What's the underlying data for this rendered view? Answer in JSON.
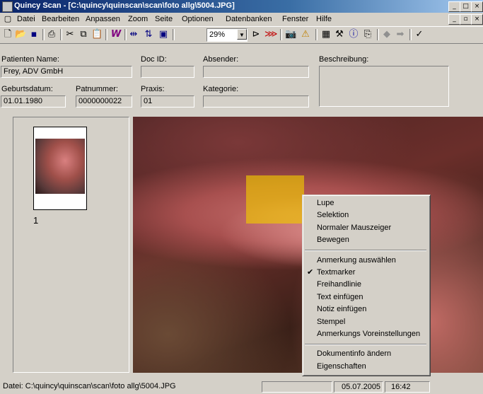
{
  "window": {
    "title": "Quincy Scan - [C:\\quincy\\quinscan\\scan\\foto allg\\5004.JPG]"
  },
  "menu": [
    "Datei",
    "Bearbeiten",
    "Anpassen",
    "Zoom",
    "Seite",
    "Optionen",
    "Datenbanken",
    "Fenster",
    "Hilfe"
  ],
  "toolbar": {
    "zoom_value": "29%"
  },
  "form": {
    "patient_name_label": "Patienten Name:",
    "patient_name": "Frey, ADV GmbH",
    "doc_id_label": "Doc ID:",
    "doc_id": "",
    "absender_label": "Absender:",
    "absender": "",
    "beschreibung_label": "Beschreibung:",
    "beschreibung": "",
    "geburtsdatum_label": "Geburtsdatum:",
    "geburtsdatum": "01.01.1980",
    "patnummer_label": "Patnummer:",
    "patnummer": "0000000022",
    "praxis_label": "Praxis:",
    "praxis": "01",
    "kategorie_label": "Kategorie:",
    "kategorie": ""
  },
  "thumbnail": {
    "page_number": "1"
  },
  "context_menu": {
    "group1": [
      "Lupe",
      "Selektion",
      "Normaler Mauszeiger",
      "Bewegen"
    ],
    "group2": [
      "Anmerkung auswählen",
      "Textmarker",
      "Freihandlinie",
      "Text einfügen",
      "Notiz einfügen",
      "Stempel",
      "Anmerkungs Voreinstellungen"
    ],
    "group3": [
      "Dokumentinfo ändern",
      "Eigenschaften"
    ],
    "checked_item": "Textmarker"
  },
  "status": {
    "file": "Datei: C:\\quincy\\quinscan\\scan\\foto allg\\5004.JPG",
    "date": "05.07.2005",
    "time": "16:42"
  }
}
